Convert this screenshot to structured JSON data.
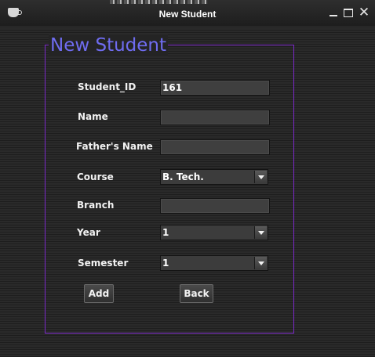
{
  "window": {
    "title": "New Student",
    "close_glyph": "✕"
  },
  "form": {
    "group_title": "New Student",
    "labels": {
      "student_id": "Student_ID",
      "name": "Name",
      "fathers_name": "Father's Name",
      "course": "Course",
      "branch": "Branch",
      "year": "Year",
      "semester": "Semester"
    },
    "values": {
      "student_id": "161",
      "name": "",
      "fathers_name": "",
      "course": "B. Tech.",
      "branch": "",
      "year": "1",
      "semester": "1"
    },
    "buttons": {
      "add": "Add",
      "back": "Back"
    }
  },
  "colors": {
    "group_border": "#7b28c9",
    "group_title": "#6f6cf0",
    "background": "#1e1e1e"
  },
  "icons": [
    "app-icon",
    "minimize-icon",
    "maximize-icon",
    "close-icon",
    "chevron-down-icon"
  ]
}
